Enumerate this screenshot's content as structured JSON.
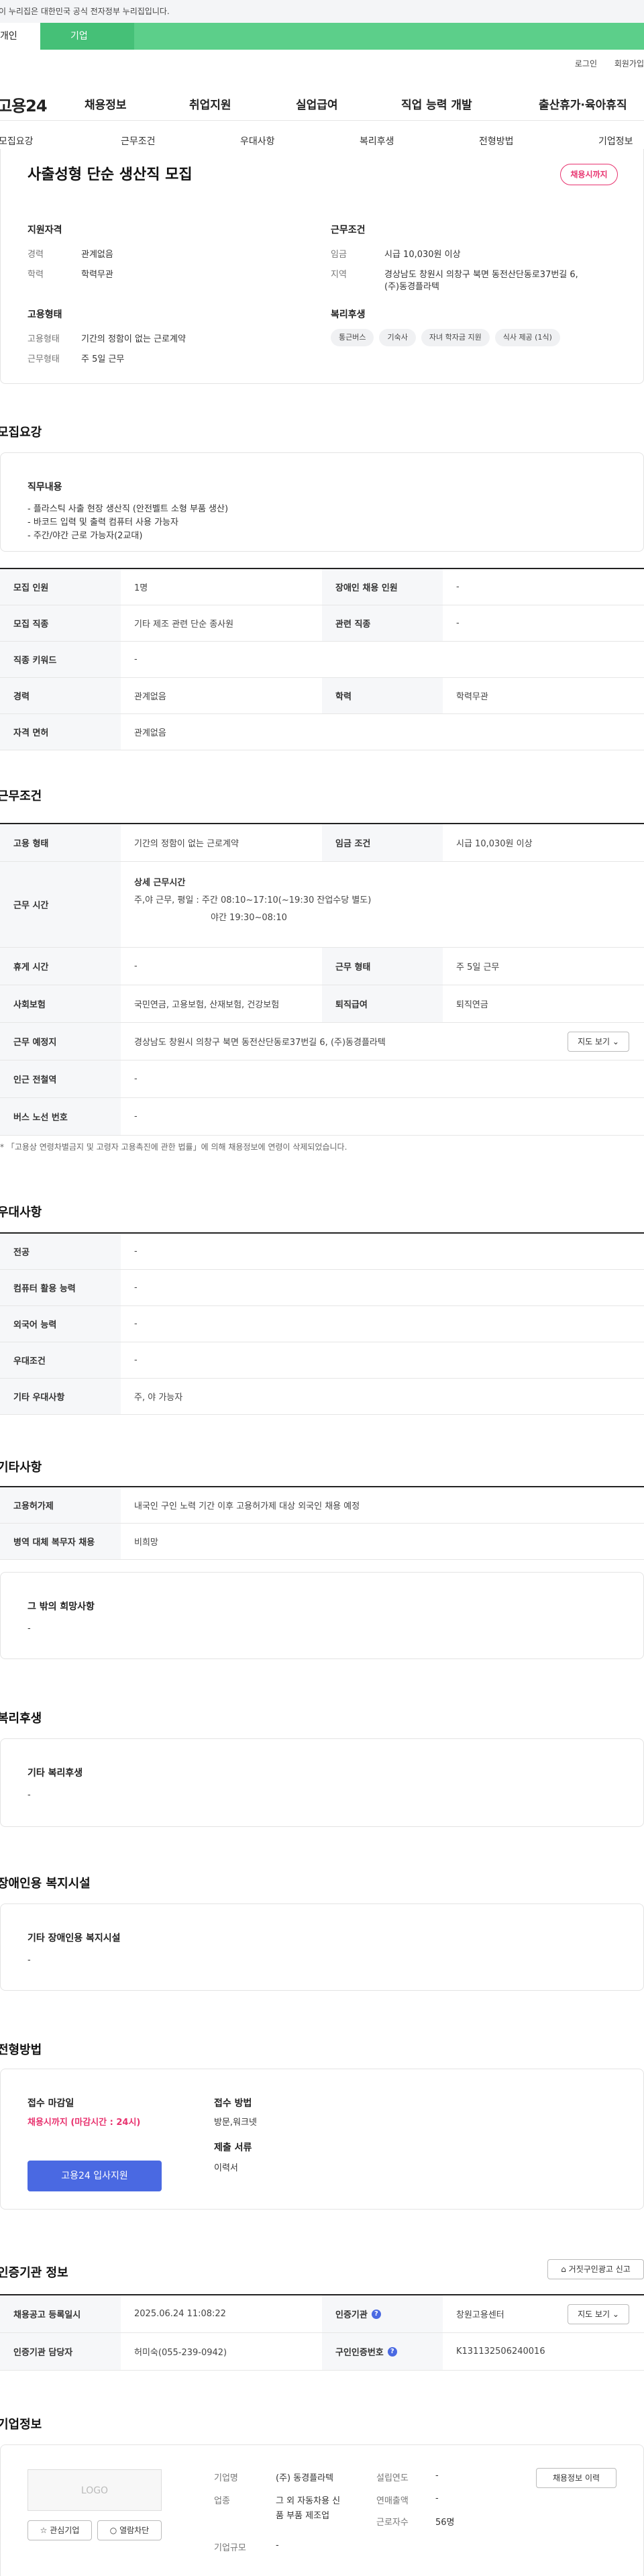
{
  "notice": "이 누리집은 대한민국 공식 전자정부 누리집입니다.",
  "user_tabs": {
    "individual": "개인",
    "company": "기업"
  },
  "util": {
    "login": "로그인",
    "signup": "회원가입"
  },
  "logo": "고용24",
  "gnb": [
    "채용정보",
    "취업지원",
    "실업급여",
    "직업 능력 개발",
    "출산휴가·육아휴직"
  ],
  "subnav": [
    "모집요강",
    "근무조건",
    "우대사항",
    "복리후생",
    "전형방법",
    "기업정보"
  ],
  "summary": {
    "title": "사출성형 단순 생산직 모집",
    "status_badge": "채용시까지",
    "qual_title": "지원자격",
    "qual": [
      {
        "k": "경력",
        "v": "관계없음"
      },
      {
        "k": "학력",
        "v": "학력무관"
      }
    ],
    "emp_title": "고용형태",
    "emp": [
      {
        "k": "고용형태",
        "v": "기간의 정함이 없는 근로계약"
      },
      {
        "k": "근무형태",
        "v": "주 5일 근무"
      }
    ],
    "cond_title": "근무조건",
    "cond": [
      {
        "k": "임금",
        "v": "시급 10,030원 이상"
      },
      {
        "k": "지역",
        "v": "경상남도 창원시 의창구 북면 동전산단동로37번길 6,"
      },
      {
        "k": "",
        "v": "(주)동경플라텍"
      }
    ],
    "welfare_title": "복리후생",
    "welfare": [
      "통근버스",
      "기숙사",
      "자녀 학자금 지원",
      "식사 제공 (1식)"
    ]
  },
  "recruit": {
    "title": "모집요강",
    "duty_title": "직무내용",
    "duties": [
      "- 플라스틱 사출 현장 생산직 (안전벨트 소형 부품 생산)",
      "- 바코드 입력 및 출력 컴퓨터 사용 가능자",
      "- 주간/야간 근로 가능자(2교대)"
    ],
    "rows": [
      {
        "k1": "모집 인원",
        "v1": "1명",
        "k2": "장애인 채용 인원",
        "v2": "-"
      },
      {
        "k1": "모집 직종",
        "v1": "기타 제조 관련 단순 종사원",
        "k2": "관련 직종",
        "v2": "-"
      },
      {
        "k1": "직종 키워드",
        "v1": "-"
      },
      {
        "k1": "경력",
        "v1": "관계없음",
        "k2": "학력",
        "v2": "학력무관"
      },
      {
        "k1": "자격 면허",
        "v1": "관계없음"
      }
    ]
  },
  "work": {
    "title": "근무조건",
    "emp_type_k": "고용 형태",
    "emp_type_v": "기간의 정함이 없는 근로계약",
    "wage_k": "임금 조건",
    "wage_v": "시급 10,030원 이상",
    "hours_k": "근무 시간",
    "hours_title": "상세 근무시간",
    "hours_lines": [
      "주,야 근무, 평일 : 주간  08:10~17:10(~19:30 잔업수당 별도)",
      "야간  19:30~08:10"
    ],
    "rest_k": "휴게 시간",
    "rest_v": "-",
    "shift_k": "근무 형태",
    "shift_v": "주 5일 근무",
    "ins_k": "사회보험",
    "ins_v": "국민연금, 고용보험, 산재보험, 건강보험",
    "ret_k": "퇴직급여",
    "ret_v": "퇴직연금",
    "place_k": "근무 예정지",
    "place_v": "경상남도 창원시 의창구 북면 동전산단동로37번길 6, (주)동경플라텍",
    "map_btn": "지도 보기",
    "subway_k": "인근 전철역",
    "subway_v": "-",
    "bus_k": "버스 노선 번호",
    "bus_v": "-",
    "note": "* 「고용상 연령차별금지 및 고령자 고용촉진에 관한 법률」에 의해 채용정보에 연령이 삭제되었습니다."
  },
  "pref": {
    "title": "우대사항",
    "rows": [
      {
        "k": "전공",
        "v": "-"
      },
      {
        "k": "컴퓨터 활용 능력",
        "v": "-"
      },
      {
        "k": "외국어 능력",
        "v": "-"
      },
      {
        "k": "우대조건",
        "v": "-"
      },
      {
        "k": "기타 우대사항",
        "v": "주, 야 가능자"
      }
    ]
  },
  "etc": {
    "title": "기타사항",
    "rows": [
      {
        "k": "고용허가제",
        "v": "내국인 구인 노력 기간 이후 고용허가제 대상 외국인 채용 예정"
      },
      {
        "k": "병역 대체 복무자 채용",
        "v": "비희망"
      }
    ],
    "wish_title": "그 밖의 희망사항",
    "wish_v": "-"
  },
  "welfare": {
    "title": "복리후생",
    "box_title": "기타 복리후생",
    "box_v": "-"
  },
  "disabled": {
    "title": "장애인용 복지시설",
    "box_title": "기타 장애인용 복지시설",
    "box_v": "-"
  },
  "process": {
    "title": "전형방법",
    "deadline_title": "접수 마감일",
    "deadline_v": "채용시까지 (마감시간 : 24시)",
    "apply_btn": "고용24 입사지원",
    "method_title": "접수 방법",
    "method_v": "방문,워크넷",
    "docs_title": "제출 서류",
    "docs_v": "이력서"
  },
  "cert": {
    "title": "인증기관 정보",
    "report_btn": "거짓구인광고 신고",
    "row1": {
      "k1": "채용공고 등록일시",
      "v1": "2025.06.24 11:08:22",
      "k2": "인증기관",
      "v2": "창원고용센터",
      "btn": "지도 보기"
    },
    "row2": {
      "k1": "인증기관 담당자",
      "v1": "허미숙(055-239-0942)",
      "k2": "구인인증번호",
      "v2": "K131132506240016"
    }
  },
  "company": {
    "title": "기업정보",
    "logo_text": "LOGO",
    "fav_btn": "관심기업",
    "block_btn": "열람차단",
    "name_k": "기업명",
    "name_v": "(주) 동경플라텍",
    "ind_k": "업종",
    "ind_v1": "그 외 자동차용 신",
    "ind_v2": "품 부품 제조업",
    "scale_k": "기업규모",
    "scale_v": "-",
    "est_k": "설립연도",
    "est_v": "-",
    "sales_k": "연매출액",
    "sales_v": "-",
    "emp_k": "근로자수",
    "emp_v": "56명",
    "info_btn": "채용정보 이력"
  },
  "colors": {
    "green": "#5ccf8a",
    "accent": "#e8336f",
    "blue": "#4a69e2"
  }
}
